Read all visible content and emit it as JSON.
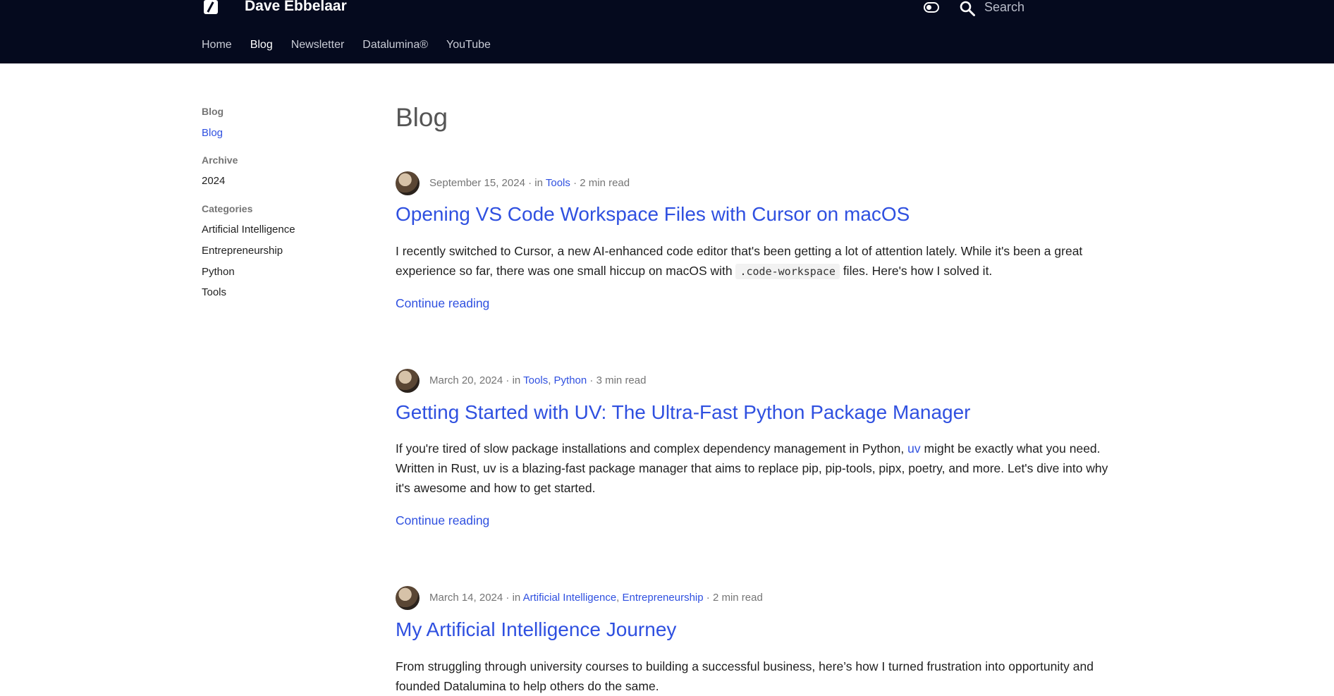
{
  "header": {
    "site_title": "Dave Ebbelaar",
    "search_placeholder": "Search",
    "nav": [
      {
        "label": "Home",
        "active": false
      },
      {
        "label": "Blog",
        "active": true
      },
      {
        "label": "Newsletter",
        "active": false
      },
      {
        "label": "Datalumina®",
        "active": false
      },
      {
        "label": "YouTube",
        "active": false
      }
    ]
  },
  "sidebar": {
    "blog_heading": "Blog",
    "blog_link": "Blog",
    "archive_heading": "Archive",
    "archive_items": [
      "2024"
    ],
    "categories_heading": "Categories",
    "categories": [
      "Artificial Intelligence",
      "Entrepreneurship",
      "Python",
      "Tools"
    ]
  },
  "main": {
    "page_title": "Blog",
    "continue_label": "Continue reading",
    "posts": [
      {
        "date": "September 15, 2024",
        "in_label": "in",
        "categories": [
          "Tools"
        ],
        "read_time": "2 min read",
        "title": "Opening VS Code Workspace Files with Cursor on macOS",
        "excerpt_1": "I recently switched to Cursor, a new AI-enhanced code editor that's been getting a lot of attention lately. While it's been a great experience so far, there was one small hiccup on macOS with",
        "excerpt_code": ".code-workspace",
        "excerpt_2": "files. Here's how I solved it."
      },
      {
        "date": "March 20, 2024",
        "in_label": "in",
        "categories": [
          "Tools",
          "Python"
        ],
        "read_time": "3 min read",
        "title": "Getting Started with UV: The Ultra-Fast Python Package Manager",
        "excerpt_1": "If you're tired of slow package installations and complex dependency management in Python,",
        "excerpt_link": "uv",
        "excerpt_2": "might be exactly what you need. Written in Rust, uv is a blazing-fast package manager that aims to replace pip, pip-tools, pipx, poetry, and more. Let's dive into why it's awesome and how to get started."
      },
      {
        "date": "March 14, 2024",
        "in_label": "in",
        "categories": [
          "Artificial Intelligence",
          "Entrepreneurship"
        ],
        "read_time": "2 min read",
        "title": "My Artificial Intelligence Journey",
        "excerpt_1": "From struggling through university courses to building a successful business, here’s how I turned frustration into opportunity and founded Datalumina to help others do the same."
      }
    ]
  },
  "colors": {
    "header_bg": "#050a1e",
    "link": "#2f50e0"
  }
}
